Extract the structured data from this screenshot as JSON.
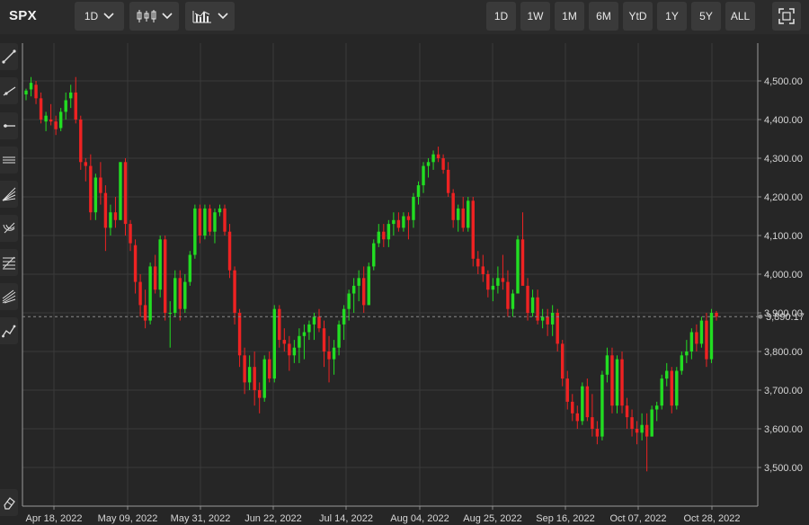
{
  "header": {
    "symbol": "SPX",
    "interval": "1D",
    "chart_type_icon": "candlestick-icon",
    "indicator_icon": "indicators-icon",
    "ranges": [
      "1D",
      "1W",
      "1M",
      "6M",
      "YtD",
      "1Y",
      "5Y",
      "ALL"
    ],
    "fullscreen_icon": "fullscreen-icon"
  },
  "tools": [
    "trend-line-icon",
    "ray-line-icon",
    "horizontal-ray-icon",
    "parallel-channel-icon",
    "fan-lines-icon",
    "fib-arc-icon",
    "fib-retracement-icon",
    "pitchfork-icon",
    "zigzag-tool-icon",
    "eraser-icon"
  ],
  "colors": {
    "up": "#22dd22",
    "down": "#ee2222",
    "background": "#262626",
    "grid": "#3a3a3a"
  },
  "last_price_label": "3,890.17",
  "chart_data": {
    "type": "candlestick",
    "x_tick_labels": [
      "Apr 18, 2022",
      "May 09, 2022",
      "May 31, 2022",
      "Jun 22, 2022",
      "Jul 14, 2022",
      "Aug 04, 2022",
      "Aug 25, 2022",
      "Sep 16, 2022",
      "Oct 07, 2022",
      "Oct 28, 2022"
    ],
    "y_tick_labels": [
      "4,500.00",
      "4,400.00",
      "4,300.00",
      "4,200.00",
      "4,100.00",
      "4,000.00",
      "3,900.00",
      "3,800.00",
      "3,700.00",
      "3,600.00",
      "3,500.00"
    ],
    "y_ticks": [
      4500,
      4400,
      4300,
      4200,
      4100,
      4000,
      3900,
      3800,
      3700,
      3600,
      3500
    ],
    "ylim": [
      3425,
      4560
    ],
    "last_price": 3890.17,
    "ohlc": [
      [
        4465,
        4480,
        4450,
        4475
      ],
      [
        4478,
        4510,
        4460,
        4495
      ],
      [
        4490,
        4500,
        4440,
        4455
      ],
      [
        4455,
        4470,
        4390,
        4400
      ],
      [
        4395,
        4420,
        4370,
        4410
      ],
      [
        4400,
        4440,
        4385,
        4395
      ],
      [
        4395,
        4410,
        4360,
        4375
      ],
      [
        4378,
        4430,
        4370,
        4420
      ],
      [
        4420,
        4470,
        4400,
        4450
      ],
      [
        4455,
        4490,
        4430,
        4470
      ],
      [
        4470,
        4510,
        4390,
        4400
      ],
      [
        4400,
        4410,
        4270,
        4290
      ],
      [
        4290,
        4300,
        4240,
        4280
      ],
      [
        4280,
        4310,
        4140,
        4160
      ],
      [
        4160,
        4260,
        4140,
        4250
      ],
      [
        4250,
        4290,
        4180,
        4210
      ],
      [
        4210,
        4230,
        4060,
        4120
      ],
      [
        4120,
        4180,
        4100,
        4160
      ],
      [
        4160,
        4200,
        4120,
        4140
      ],
      [
        4140,
        4290,
        4140,
        4290
      ],
      [
        4290,
        4300,
        4100,
        4130
      ],
      [
        4130,
        4140,
        4060,
        4080
      ],
      [
        4075,
        4090,
        3950,
        3980
      ],
      [
        3980,
        4000,
        3890,
        3920
      ],
      [
        3920,
        3960,
        3860,
        3880
      ],
      [
        3880,
        4030,
        3870,
        4020
      ],
      [
        4020,
        4050,
        3950,
        3960
      ],
      [
        3960,
        4100,
        3940,
        4090
      ],
      [
        4090,
        4100,
        3880,
        3900
      ],
      [
        3900,
        3930,
        3810,
        3900
      ],
      [
        3900,
        4010,
        3890,
        3990
      ],
      [
        3990,
        4010,
        3880,
        3910
      ],
      [
        3910,
        4000,
        3900,
        3980
      ],
      [
        3980,
        4060,
        3970,
        4050
      ],
      [
        4050,
        4180,
        4040,
        4170
      ],
      [
        4170,
        4180,
        4080,
        4100
      ],
      [
        4100,
        4180,
        4090,
        4170
      ],
      [
        4170,
        4180,
        4100,
        4110
      ],
      [
        4110,
        4170,
        4080,
        4160
      ],
      [
        4160,
        4180,
        4150,
        4170
      ],
      [
        4170,
        4180,
        4100,
        4110
      ],
      [
        4110,
        4130,
        3990,
        4010
      ],
      [
        4010,
        4020,
        3870,
        3900
      ],
      [
        3900,
        3910,
        3760,
        3790
      ],
      [
        3790,
        3810,
        3690,
        3720
      ],
      [
        3720,
        3790,
        3700,
        3760
      ],
      [
        3760,
        3800,
        3660,
        3700
      ],
      [
        3700,
        3720,
        3640,
        3680
      ],
      [
        3680,
        3790,
        3670,
        3780
      ],
      [
        3780,
        3800,
        3720,
        3730
      ],
      [
        3730,
        3920,
        3720,
        3910
      ],
      [
        3910,
        3920,
        3810,
        3830
      ],
      [
        3830,
        3860,
        3800,
        3820
      ],
      [
        3820,
        3840,
        3750,
        3790
      ],
      [
        3790,
        3830,
        3770,
        3810
      ],
      [
        3810,
        3860,
        3770,
        3840
      ],
      [
        3840,
        3870,
        3780,
        3850
      ],
      [
        3850,
        3880,
        3830,
        3870
      ],
      [
        3870,
        3900,
        3830,
        3890
      ],
      [
        3890,
        3910,
        3850,
        3860
      ],
      [
        3860,
        3880,
        3760,
        3800
      ],
      [
        3800,
        3840,
        3720,
        3780
      ],
      [
        3780,
        3830,
        3740,
        3810
      ],
      [
        3810,
        3880,
        3790,
        3870
      ],
      [
        3870,
        3920,
        3830,
        3910
      ],
      [
        3910,
        3960,
        3880,
        3950
      ],
      [
        3950,
        3990,
        3900,
        3970
      ],
      [
        3970,
        4010,
        3930,
        3990
      ],
      [
        3990,
        4020,
        3900,
        3920
      ],
      [
        3920,
        4030,
        3920,
        4020
      ],
      [
        4020,
        4090,
        4010,
        4080
      ],
      [
        4080,
        4130,
        4070,
        4110
      ],
      [
        4110,
        4130,
        4070,
        4090
      ],
      [
        4090,
        4140,
        4070,
        4130
      ],
      [
        4130,
        4160,
        4100,
        4140
      ],
      [
        4140,
        4160,
        4110,
        4120
      ],
      [
        4120,
        4160,
        4110,
        4150
      ],
      [
        4150,
        4160,
        4090,
        4140
      ],
      [
        4140,
        4210,
        4120,
        4200
      ],
      [
        4200,
        4240,
        4180,
        4230
      ],
      [
        4230,
        4290,
        4210,
        4280
      ],
      [
        4280,
        4300,
        4250,
        4290
      ],
      [
        4290,
        4320,
        4270,
        4310
      ],
      [
        4310,
        4330,
        4290,
        4300
      ],
      [
        4300,
        4310,
        4260,
        4270
      ],
      [
        4270,
        4290,
        4200,
        4210
      ],
      [
        4210,
        4220,
        4120,
        4140
      ],
      [
        4140,
        4180,
        4110,
        4170
      ],
      [
        4170,
        4200,
        4110,
        4120
      ],
      [
        4120,
        4200,
        4110,
        4190
      ],
      [
        4190,
        4200,
        4020,
        4040
      ],
      [
        4040,
        4060,
        4000,
        4020
      ],
      [
        4020,
        4050,
        3980,
        4000
      ],
      [
        4000,
        4010,
        3940,
        3960
      ],
      [
        3960,
        3990,
        3930,
        3970
      ],
      [
        3970,
        4020,
        3950,
        3990
      ],
      [
        3990,
        4050,
        3960,
        3980
      ],
      [
        3980,
        4010,
        3890,
        3910
      ],
      [
        3910,
        3960,
        3890,
        3950
      ],
      [
        3950,
        4100,
        3950,
        4090
      ],
      [
        4090,
        4160,
        4080,
        3970
      ],
      [
        3970,
        3990,
        3880,
        3900
      ],
      [
        3900,
        3960,
        3890,
        3940
      ],
      [
        3940,
        3960,
        3870,
        3880
      ],
      [
        3880,
        3910,
        3860,
        3890
      ],
      [
        3890,
        3910,
        3840,
        3870
      ],
      [
        3870,
        3920,
        3840,
        3900
      ],
      [
        3900,
        3910,
        3800,
        3820
      ],
      [
        3820,
        3830,
        3710,
        3730
      ],
      [
        3730,
        3750,
        3650,
        3670
      ],
      [
        3670,
        3690,
        3620,
        3640
      ],
      [
        3640,
        3660,
        3600,
        3620
      ],
      [
        3620,
        3720,
        3610,
        3710
      ],
      [
        3710,
        3730,
        3620,
        3630
      ],
      [
        3630,
        3690,
        3580,
        3600
      ],
      [
        3600,
        3620,
        3560,
        3580
      ],
      [
        3580,
        3750,
        3570,
        3740
      ],
      [
        3740,
        3810,
        3720,
        3790
      ],
      [
        3790,
        3810,
        3640,
        3660
      ],
      [
        3660,
        3790,
        3640,
        3780
      ],
      [
        3780,
        3800,
        3640,
        3660
      ],
      [
        3660,
        3680,
        3600,
        3630
      ],
      [
        3630,
        3650,
        3580,
        3600
      ],
      [
        3600,
        3620,
        3560,
        3590
      ],
      [
        3590,
        3640,
        3570,
        3610
      ],
      [
        3610,
        3640,
        3490,
        3580
      ],
      [
        3580,
        3660,
        3580,
        3650
      ],
      [
        3650,
        3670,
        3620,
        3660
      ],
      [
        3660,
        3740,
        3650,
        3730
      ],
      [
        3730,
        3770,
        3710,
        3750
      ],
      [
        3750,
        3760,
        3640,
        3660
      ],
      [
        3660,
        3760,
        3650,
        3750
      ],
      [
        3750,
        3800,
        3740,
        3790
      ],
      [
        3790,
        3830,
        3770,
        3800
      ],
      [
        3800,
        3860,
        3780,
        3850
      ],
      [
        3850,
        3870,
        3800,
        3820
      ],
      [
        3820,
        3890,
        3810,
        3880
      ],
      [
        3880,
        3900,
        3760,
        3780
      ],
      [
        3780,
        3910,
        3770,
        3900
      ],
      [
        3900,
        3905,
        3880,
        3890
      ]
    ]
  }
}
